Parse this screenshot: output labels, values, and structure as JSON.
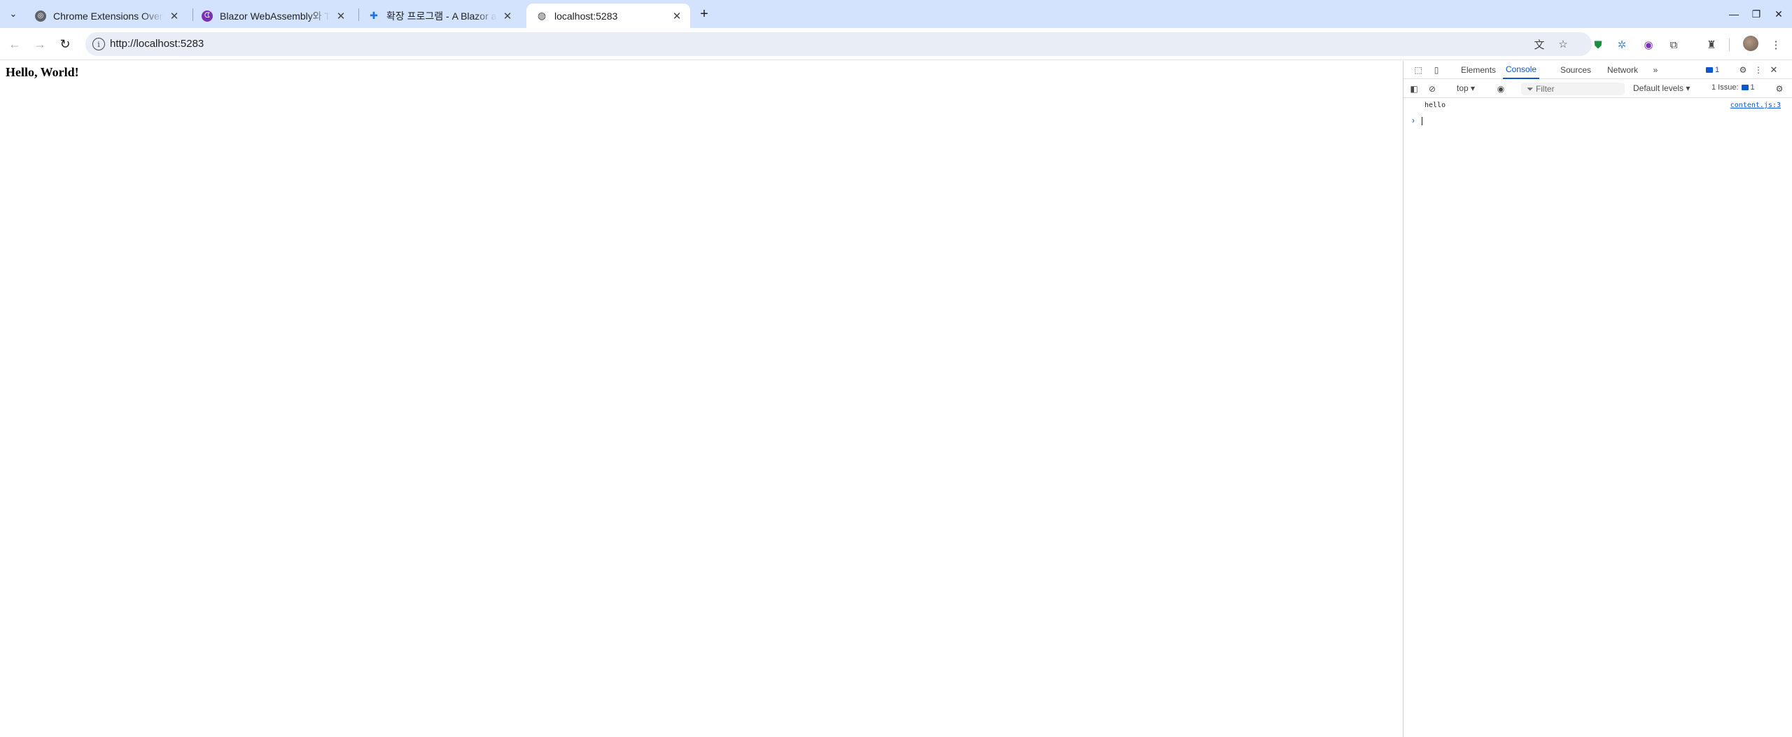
{
  "browser": {
    "tabs": [
      {
        "title": "Chrome Extensions Overview",
        "favicon": "chrome-icon",
        "active": false
      },
      {
        "title": "Blazor WebAssembly와 TypeScript",
        "favicon": "blazor-icon",
        "active": false
      },
      {
        "title": "확장 프로그램 - A Blazor and",
        "favicon": "puzzle-icon",
        "active": false
      },
      {
        "title": "localhost:5283",
        "favicon": "globe-icon",
        "active": true
      }
    ],
    "address": "http://localhost:5283",
    "accent_color": "#d3e3fd"
  },
  "page": {
    "heading": "Hello, World!"
  },
  "devtools": {
    "tabs": [
      "Elements",
      "Console",
      "Sources",
      "Network"
    ],
    "active_tab": "Console",
    "message_badge": "1",
    "context": "top",
    "filter_placeholder": "Filter",
    "levels": "Default levels",
    "issues_label": "1 Issue:",
    "issues_count": "1",
    "console": [
      {
        "message": "hello",
        "source": "content.js:3"
      }
    ]
  }
}
